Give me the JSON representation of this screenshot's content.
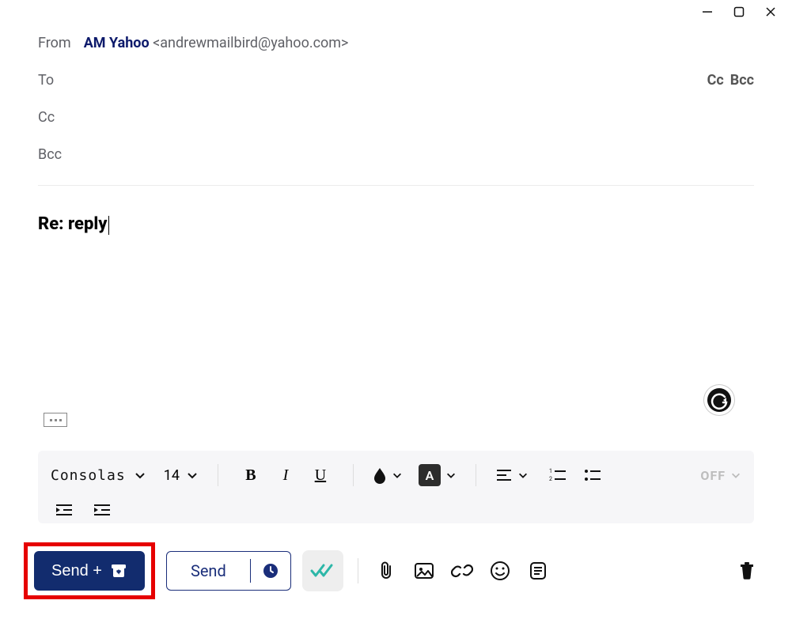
{
  "titlebar": {
    "min": "minimize",
    "max": "maximize",
    "close": "close"
  },
  "from": {
    "label": "From",
    "account_name": "AM Yahoo",
    "email": "<andrewmailbird@yahoo.com>"
  },
  "to": {
    "label": "To",
    "cc_link": "Cc",
    "bcc_link": "Bcc"
  },
  "cc": {
    "label": "Cc"
  },
  "bcc": {
    "label": "Bcc"
  },
  "subject": "Re: reply",
  "format": {
    "font": "Consolas",
    "size": "14",
    "off": "OFF",
    "bold": "B",
    "italic": "I",
    "underline": "U",
    "highlight": "A"
  },
  "actions": {
    "send_archive": "Send  +",
    "send": "Send"
  }
}
